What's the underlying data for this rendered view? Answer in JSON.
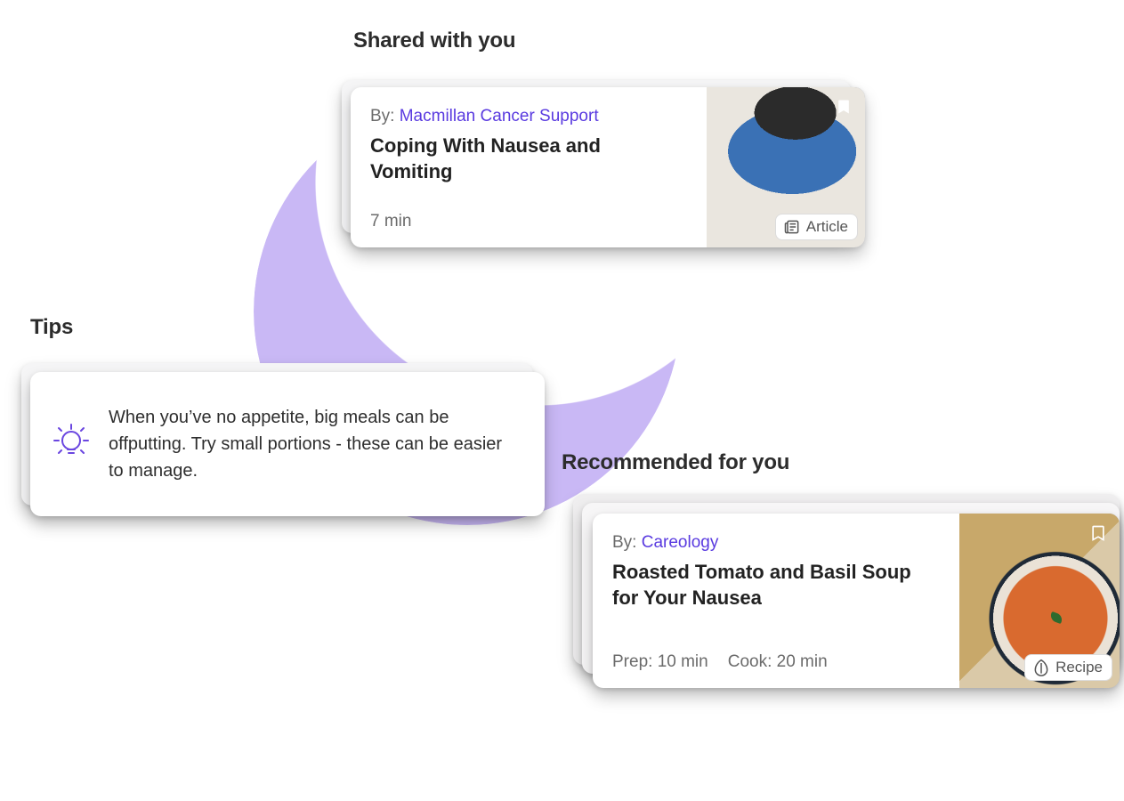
{
  "shared": {
    "heading": "Shared with you",
    "by_prefix": "By:",
    "author": "Macmillan Cancer Support",
    "title": "Coping With Nausea and Vomiting",
    "read_time": "7 min",
    "badge_label": "Article"
  },
  "tips": {
    "heading": "Tips",
    "text": "When you’ve no appetite, big meals can be offputting. Try small portions - these can be easier to manage."
  },
  "recommended": {
    "heading": "Recommended for you",
    "by_prefix": "By:",
    "author": "Careology",
    "title": "Roasted Tomato and Basil Soup for Your Nausea",
    "prep_label": "Prep: 10 min",
    "cook_label": "Cook: 20 min",
    "badge_label": "Recipe"
  }
}
